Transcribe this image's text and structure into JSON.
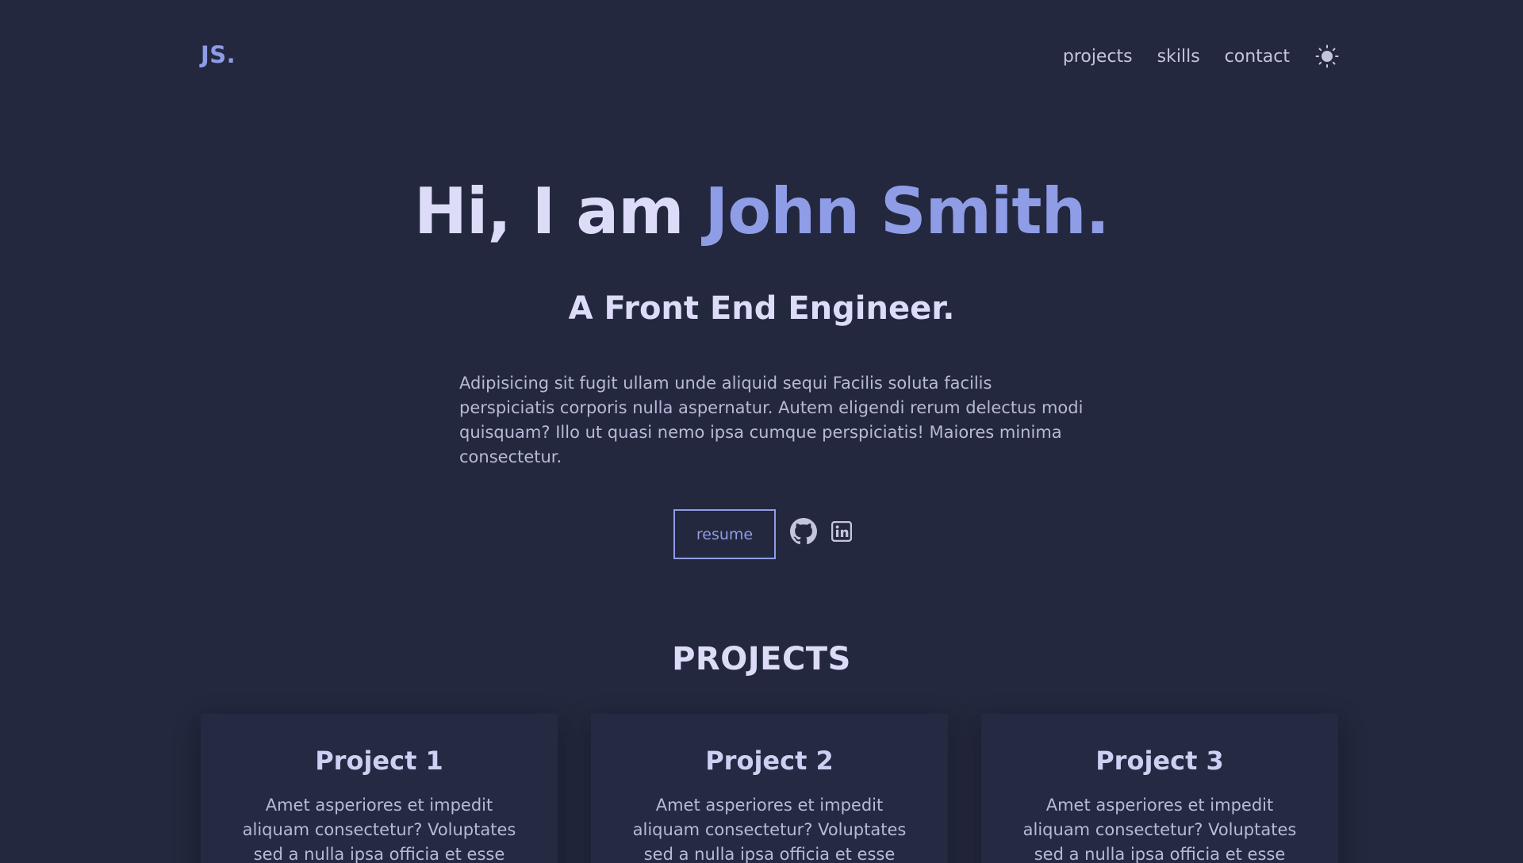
{
  "header": {
    "logo": "JS.",
    "nav": [
      {
        "label": "projects"
      },
      {
        "label": "skills"
      },
      {
        "label": "contact"
      }
    ],
    "theme_toggle_icon": "sun-icon"
  },
  "hero": {
    "greeting": "Hi, I am ",
    "name": "John Smith.",
    "subtitle": "A Front End Engineer.",
    "description": "Adipisicing sit fugit ullam unde aliquid sequi Facilis soluta facilis perspiciatis corporis nulla aspernatur. Autem eligendi rerum delectus modi quisquam? Illo ut quasi nemo ipsa cumque perspiciatis! Maiores minima consectetur.",
    "resume_label": "resume",
    "social_icons": [
      "github-icon",
      "linkedin-icon"
    ]
  },
  "projects": {
    "title": "PROJECTS",
    "items": [
      {
        "title": "Project 1",
        "description": "Amet asperiores et impedit aliquam consectetur? Voluptates sed a nulla ipsa officia et esse"
      },
      {
        "title": "Project 2",
        "description": "Amet asperiores et impedit aliquam consectetur? Voluptates sed a nulla ipsa officia et esse"
      },
      {
        "title": "Project 3",
        "description": "Amet asperiores et impedit aliquam consectetur? Voluptates sed a nulla ipsa officia et esse"
      }
    ]
  },
  "colors": {
    "background": "#23283e",
    "accent": "#8f9ce6",
    "heading": "#dcdcf8",
    "text": "#b8b9d6"
  }
}
